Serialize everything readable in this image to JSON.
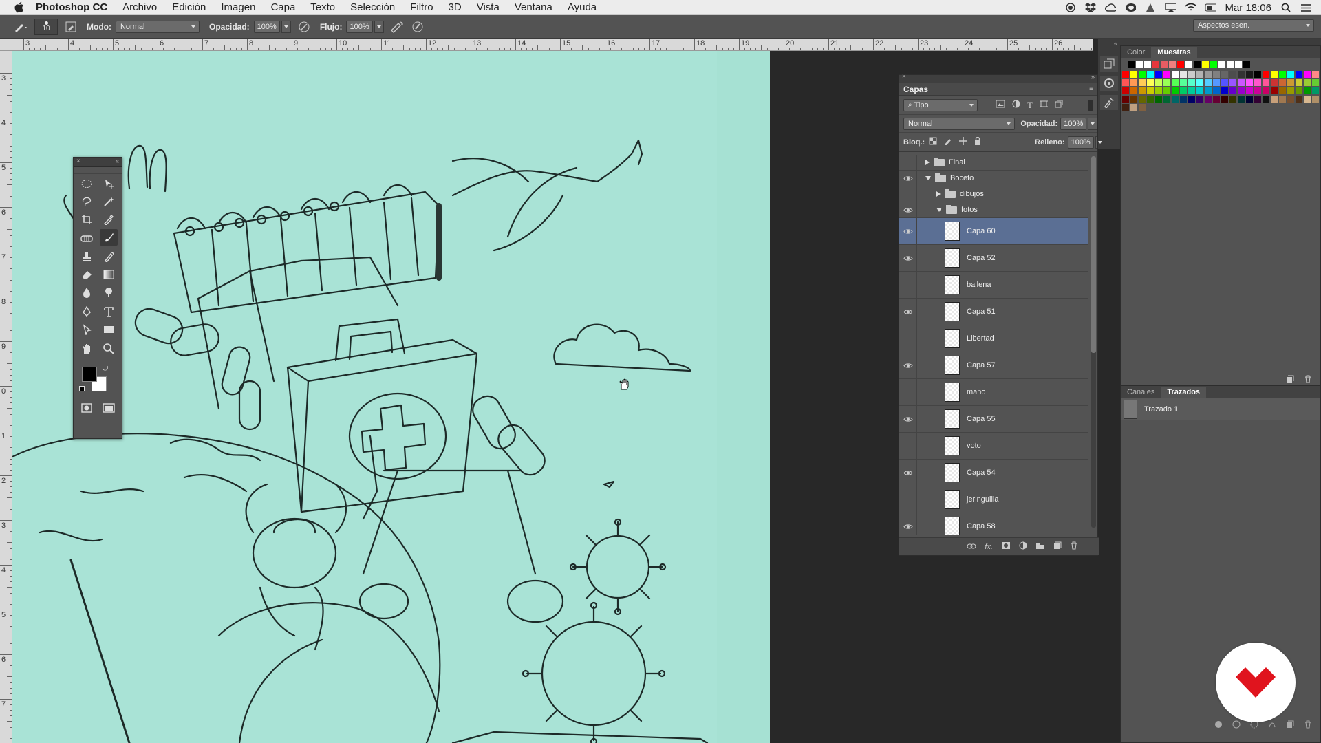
{
  "menubar": {
    "app": "Photoshop CC",
    "items": [
      "Archivo",
      "Edición",
      "Imagen",
      "Capa",
      "Texto",
      "Selección",
      "Filtro",
      "3D",
      "Vista",
      "Ventana",
      "Ayuda"
    ],
    "clock": "Mar 18:06"
  },
  "options": {
    "brush_size": "10",
    "mode_label": "Modo:",
    "mode_value": "Normal",
    "opacity_label": "Opacidad:",
    "opacity_value": "100%",
    "flow_label": "Flujo:",
    "flow_value": "100%",
    "workspace": "Aspectos esen."
  },
  "rulers": {
    "top": [
      "3",
      "4",
      "5",
      "6",
      "7",
      "8",
      "9",
      "10",
      "11",
      "12",
      "13",
      "14",
      "15",
      "16",
      "17",
      "18",
      "19",
      "20",
      "21",
      "22",
      "23",
      "24",
      "25",
      "26"
    ],
    "left": [
      "3",
      "4",
      "5",
      "6",
      "7",
      "8",
      "9",
      "0",
      "1",
      "2",
      "3",
      "4",
      "5",
      "6",
      "7"
    ]
  },
  "layers": {
    "title": "Capas",
    "filter": "Tipo",
    "blend": "Normal",
    "opacity_label": "Opacidad:",
    "opacity_value": "100%",
    "lock_label": "Bloq.:",
    "fill_label": "Relleno:",
    "fill_value": "100%",
    "rows": [
      {
        "name": "Final",
        "visible": false,
        "kind": "group",
        "indent": 0,
        "open": false
      },
      {
        "name": "Boceto",
        "visible": true,
        "kind": "group",
        "indent": 0,
        "open": true
      },
      {
        "name": "dibujos",
        "visible": false,
        "kind": "group",
        "indent": 1,
        "open": false
      },
      {
        "name": "fotos",
        "visible": true,
        "kind": "group",
        "indent": 1,
        "open": true
      },
      {
        "name": "Capa 60",
        "visible": true,
        "kind": "layer",
        "selected": true
      },
      {
        "name": "Capa 52",
        "visible": true,
        "kind": "layer"
      },
      {
        "name": "ballena",
        "visible": false,
        "kind": "layer"
      },
      {
        "name": "Capa 51",
        "visible": true,
        "kind": "layer"
      },
      {
        "name": "Libertad",
        "visible": false,
        "kind": "layer"
      },
      {
        "name": "Capa 57",
        "visible": true,
        "kind": "layer"
      },
      {
        "name": "mano",
        "visible": false,
        "kind": "layer"
      },
      {
        "name": "Capa 55",
        "visible": true,
        "kind": "layer"
      },
      {
        "name": "voto",
        "visible": false,
        "kind": "layer"
      },
      {
        "name": "Capa 54",
        "visible": true,
        "kind": "layer"
      },
      {
        "name": "jeringuilla",
        "visible": false,
        "kind": "layer"
      },
      {
        "name": "Capa 58",
        "visible": true,
        "kind": "layer"
      }
    ]
  },
  "swatches": {
    "tab_color": "Color",
    "tab_swatches": "Muestras"
  },
  "paths": {
    "tab_channels": "Canales",
    "tab_paths": "Trazados",
    "item": "Trazado 1"
  },
  "colors": {
    "canvas": "#a9e3d6",
    "ui": "#535353",
    "selection": "#5b6f94",
    "logo": "#e0141e"
  }
}
